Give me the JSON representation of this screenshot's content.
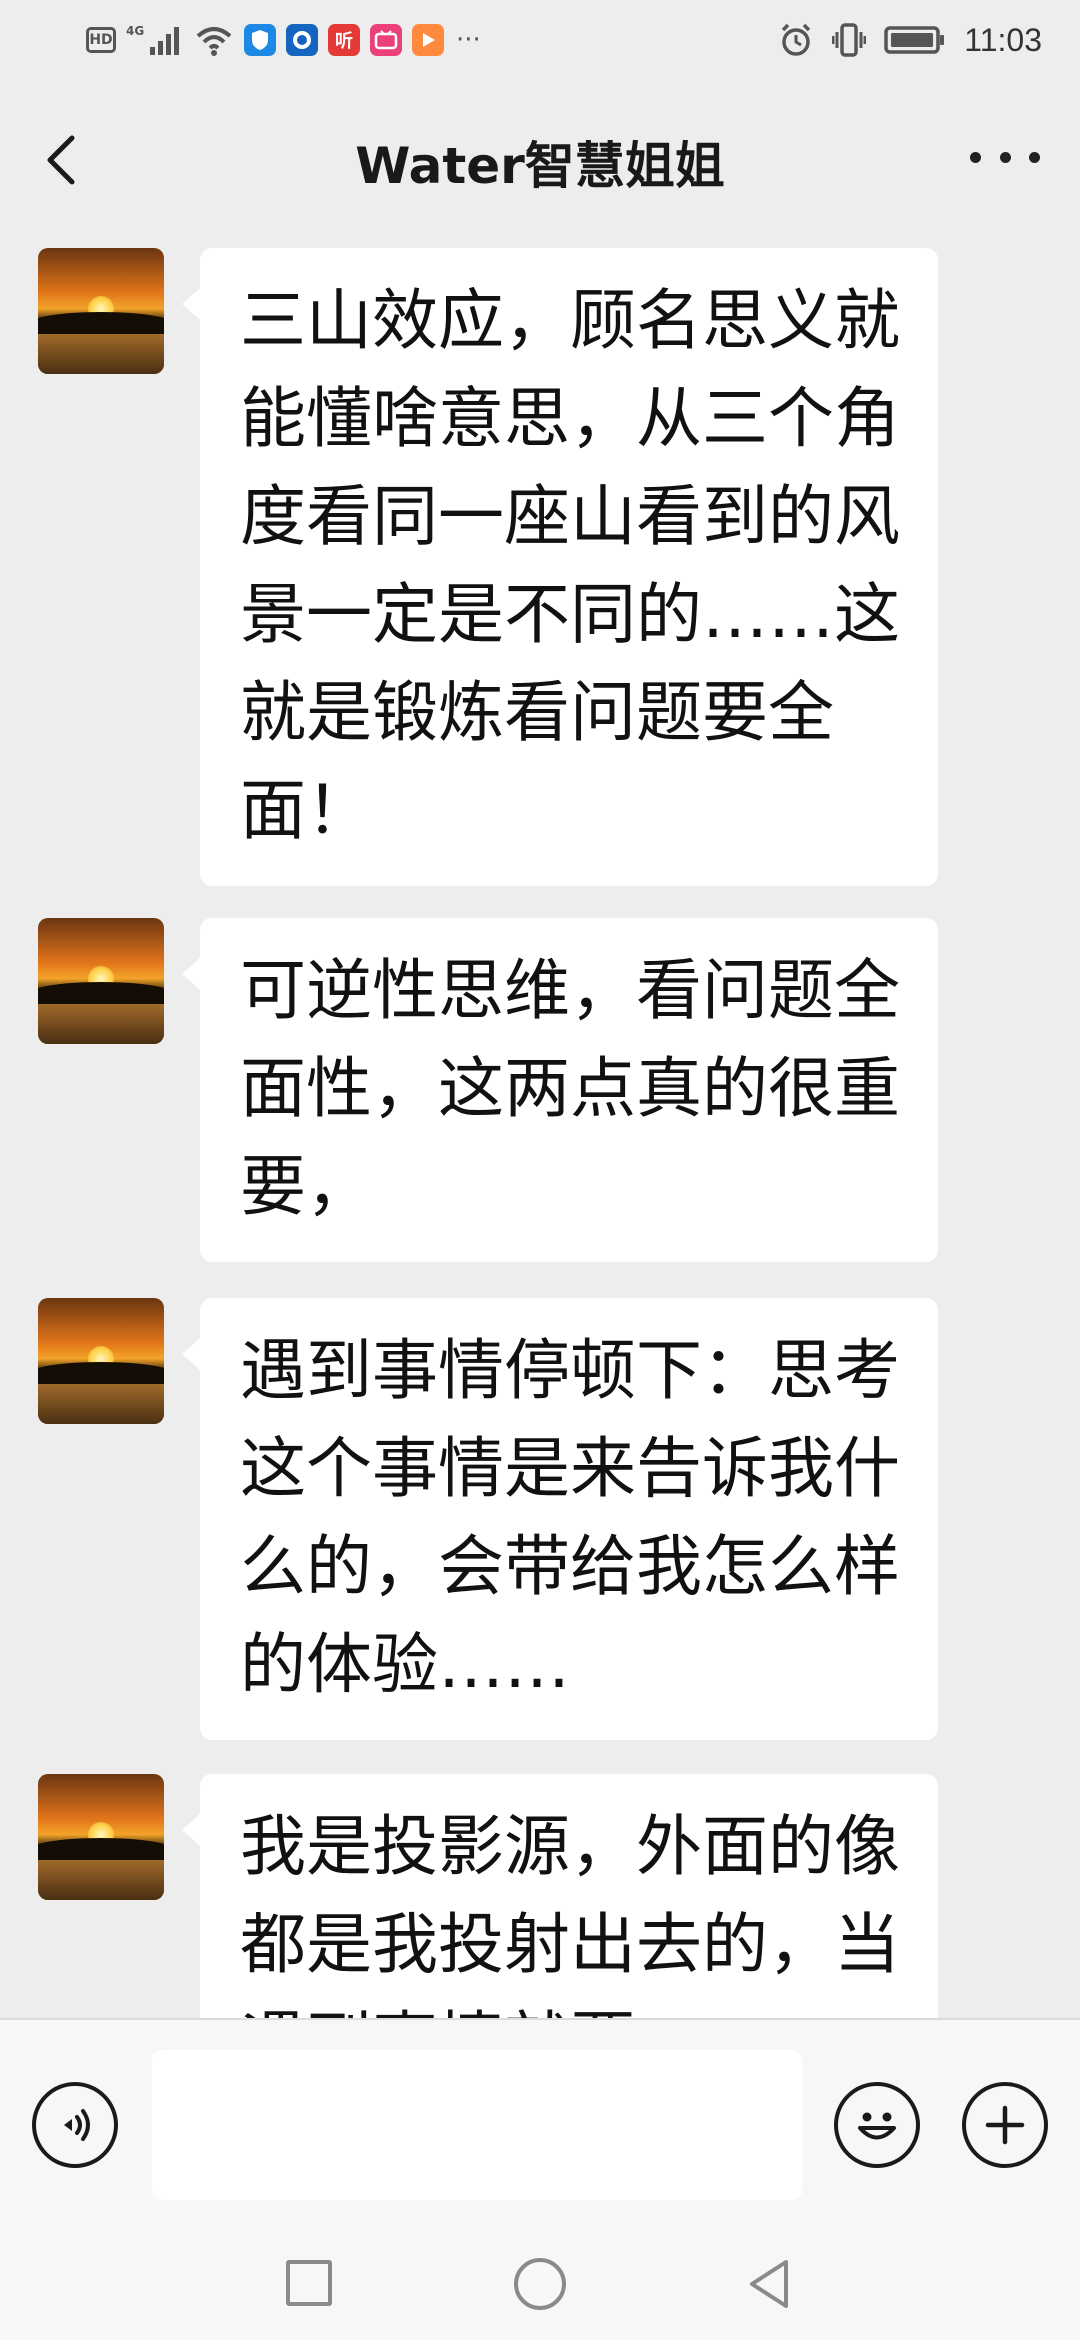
{
  "status_bar": {
    "network_badge": "HD",
    "network_type": "4G",
    "notification_icons": [
      "hd-icon",
      "signal-icon",
      "wifi-icon",
      "shield-app-icon",
      "browser-app-icon",
      "listen-app-icon",
      "bilibili-app-icon",
      "video-app-icon"
    ],
    "listen_app_char": "听",
    "more_label": "···",
    "right_icons": [
      "alarm-icon",
      "vibrate-icon",
      "battery-icon"
    ],
    "time": "11:03"
  },
  "title_bar": {
    "title": "Water智慧姐姐",
    "back_icon": "chevron-left-icon",
    "more_icon": "more-dots-icon"
  },
  "messages": [
    {
      "sender": "other",
      "text": "三山效应，顾名思义就能懂啥意思，从三个角度看同一座山看到的风景一定是不同的……这就是锻炼看问题要全面！"
    },
    {
      "sender": "other",
      "text": "可逆性思维，看问题全面性，这两点真的很重要，"
    },
    {
      "sender": "other",
      "text": "遇到事情停顿下：思考这个事情是来告诉我什么的，会带给我怎么样的体验……"
    },
    {
      "sender": "other",
      "text": "我是投影源，外面的像都是我投射出去的，当遇到事情就要"
    }
  ],
  "input_bar": {
    "voice_icon": "voice-icon",
    "input_value": "",
    "emoji_icon": "emoji-icon",
    "plus_icon": "plus-icon"
  },
  "nav_bar": {
    "icons": [
      "recent-apps-icon",
      "home-icon",
      "back-icon"
    ]
  }
}
